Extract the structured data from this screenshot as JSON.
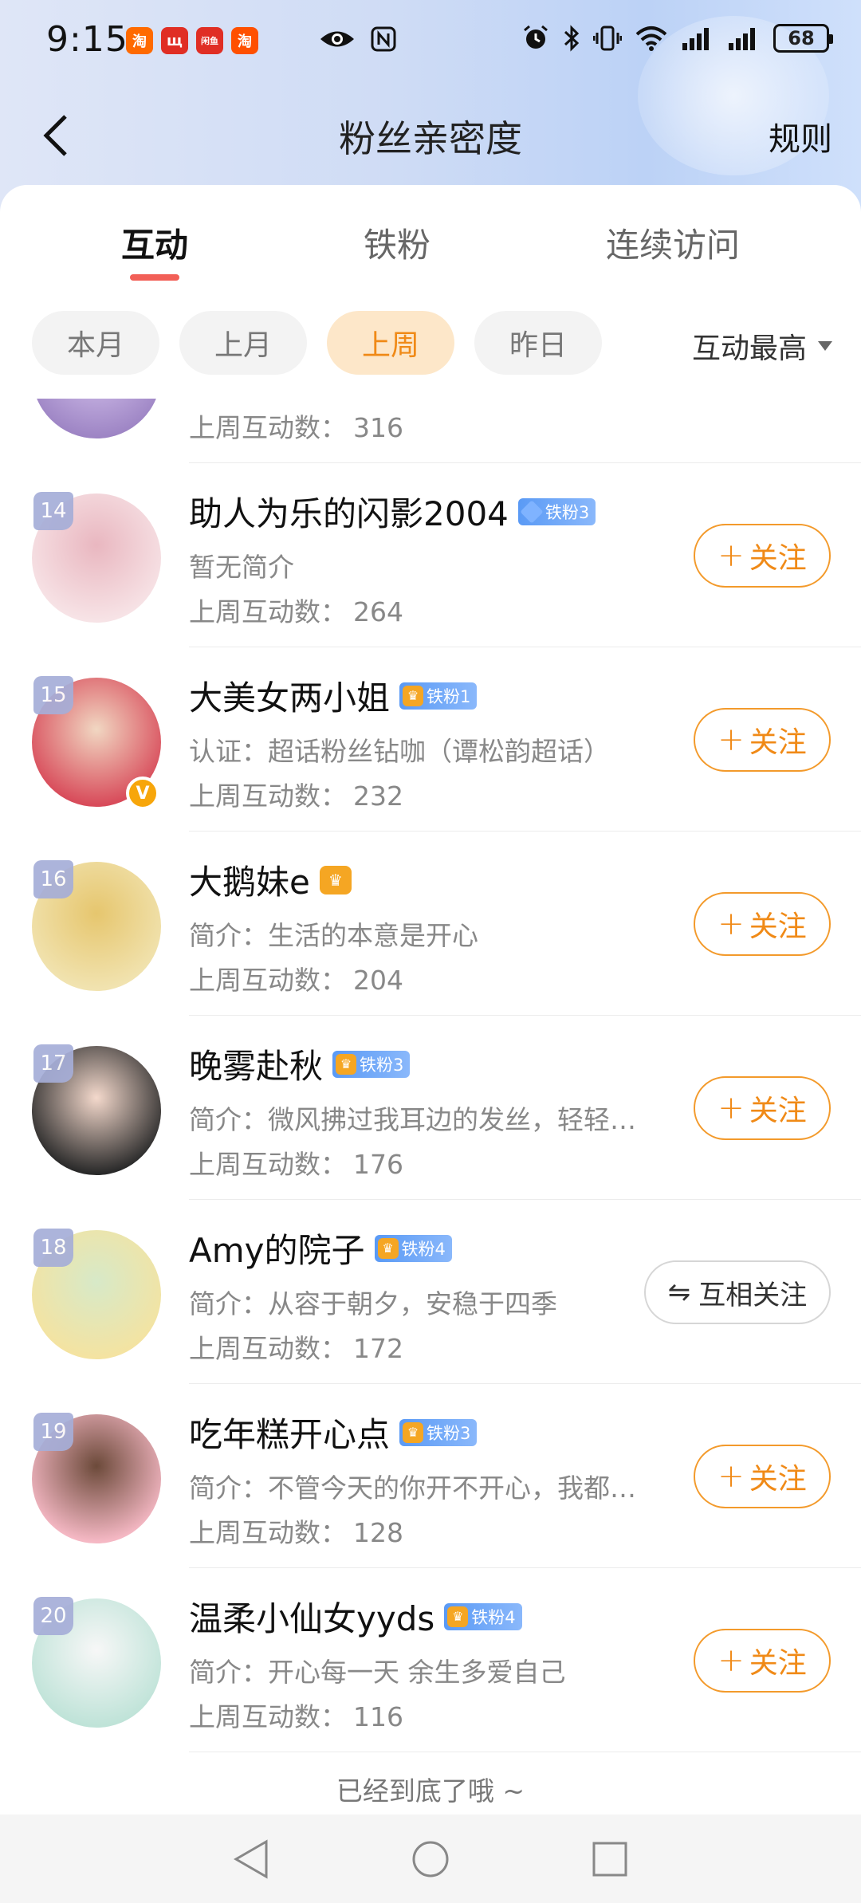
{
  "status_bar": {
    "time": "9:15",
    "app_icons": [
      {
        "name": "taobao-icon",
        "glyph": "淘"
      },
      {
        "name": "app-icon-2",
        "glyph": "щ"
      },
      {
        "name": "xianyu-icon",
        "glyph": "闲鱼"
      },
      {
        "name": "taobao-icon-2",
        "glyph": "淘"
      }
    ],
    "battery": "68"
  },
  "header": {
    "title": "粉丝亲密度",
    "rules_label": "规则"
  },
  "tabs": [
    {
      "label": "互动",
      "active": true
    },
    {
      "label": "铁粉",
      "active": false
    },
    {
      "label": "连续访问",
      "active": false
    }
  ],
  "filters": [
    {
      "label": "本月",
      "active": false
    },
    {
      "label": "上月",
      "active": false
    },
    {
      "label": "上周",
      "active": true
    },
    {
      "label": "昨日",
      "active": false
    }
  ],
  "sort_label": "互动最高",
  "count_prefix": "上周互动数：",
  "partial_row": {
    "count": "316"
  },
  "fans": [
    {
      "rank": "14",
      "name": "助人为乐的闪影2004",
      "badge": "铁粉3",
      "badge_type": "diamond",
      "bio": "暂无简介",
      "count": "264",
      "action": "关注",
      "verified": false,
      "avatar_colors": [
        "#f7e3e6",
        "#e9b7c0"
      ]
    },
    {
      "rank": "15",
      "name": "大美女两小姐",
      "badge": "铁粉1",
      "badge_type": "crown",
      "bio": "认证：超话粉丝钻咖（谭松韵超话）",
      "count": "232",
      "action": "关注",
      "verified": true,
      "avatar_colors": [
        "#d84b5a",
        "#f1d7c2"
      ]
    },
    {
      "rank": "16",
      "name": "大鹅妹e",
      "badge": "",
      "badge_type": "crown-only",
      "bio": "简介：生活的本意是开心",
      "count": "204",
      "action": "关注",
      "verified": false,
      "avatar_colors": [
        "#f1e3b0",
        "#e6c66e"
      ]
    },
    {
      "rank": "17",
      "name": "晚雾赴秋",
      "badge": "铁粉3",
      "badge_type": "crown",
      "bio": "简介：微风拂过我耳边的发丝，轻轻…",
      "count": "176",
      "action": "关注",
      "verified": false,
      "avatar_colors": [
        "#2a2a2a",
        "#f4d9cc"
      ]
    },
    {
      "rank": "18",
      "name": "Amy的院子",
      "badge": "铁粉4",
      "badge_type": "crown",
      "bio": "简介：从容于朝夕，安稳于四季",
      "count": "172",
      "action": "互相关注",
      "verified": false,
      "avatar_colors": [
        "#f4e3a1",
        "#d7e9c8"
      ]
    },
    {
      "rank": "19",
      "name": "吃年糕开心点",
      "badge": "铁粉3",
      "badge_type": "crown",
      "bio": "简介：不管今天的你开不开心，我都…",
      "count": "128",
      "action": "关注",
      "verified": false,
      "avatar_colors": [
        "#f5b8c4",
        "#6c4a3a"
      ]
    },
    {
      "rank": "20",
      "name": "温柔小仙女yyds",
      "badge": "铁粉4",
      "badge_type": "crown",
      "bio": "简介：开心每一天 余生多爱自己",
      "count": "116",
      "action": "关注",
      "verified": false,
      "avatar_colors": [
        "#bfe3d8",
        "#f7f7f7"
      ]
    }
  ],
  "end_text": "已经到底了哦 ~",
  "colors": {
    "accent": "#f08a17",
    "tab_underline": "#f25f57",
    "chip_active_bg": "#fde7c9"
  }
}
